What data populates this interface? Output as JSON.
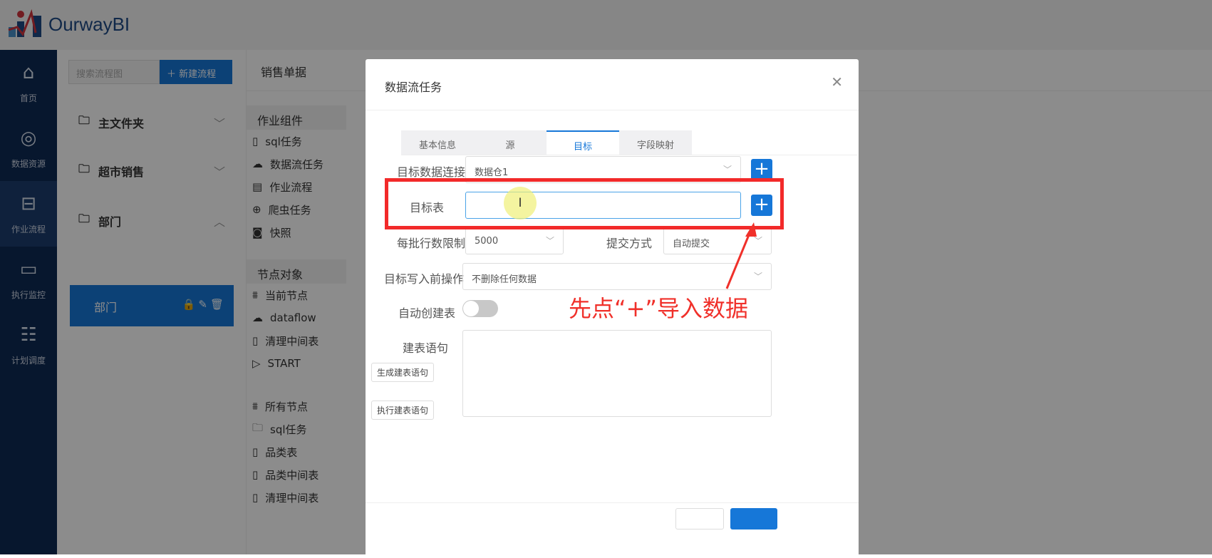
{
  "app": {
    "brand": "OurwayBI"
  },
  "sidebar": {
    "items": [
      {
        "label": "首页",
        "icon": "home-icon"
      },
      {
        "label": "数据资源",
        "icon": "globe-icon"
      },
      {
        "label": "作业流程",
        "icon": "flow-icon"
      },
      {
        "label": "执行监控",
        "icon": "monitor-icon"
      },
      {
        "label": "计划调度",
        "icon": "schedule-icon"
      }
    ]
  },
  "tree": {
    "search_placeholder": "搜索流程图",
    "new_button": "新建流程",
    "folders": [
      "主文件夹",
      "超市销售",
      "部门"
    ],
    "selected": "部门"
  },
  "panel": {
    "tab": "销售单据",
    "components_title": "作业组件",
    "components": [
      "sql任务",
      "数据流任务",
      "作业流程",
      "爬虫任务",
      "快照"
    ],
    "nodes_title": "节点对象",
    "current_nodes_label": "当前节点",
    "current_nodes": [
      "dataflow",
      "清理中间表",
      "START"
    ],
    "all_nodes_label": "所有节点",
    "all_nodes": [
      "sql任务",
      "品类表",
      "品类中间表",
      "清理中间表"
    ]
  },
  "modal": {
    "title": "数据流任务",
    "tabs": [
      "基本信息",
      "源",
      "目标",
      "字段映射"
    ],
    "active_tab": "目标",
    "target_conn_label": "目标数据连接",
    "target_conn_value": "数据仓1",
    "target_table_label": "目标表",
    "target_table_value": "",
    "batch_label": "每批行数限制",
    "batch_value": "5000",
    "commit_label": "提交方式",
    "commit_value": "自动提交",
    "pre_op_label": "目标写入前操作",
    "pre_op_value": "不删除任何数据",
    "auto_create_label": "自动创建表",
    "auto_create_on": false,
    "ddl_label": "建表语句",
    "gen_ddl": "生成建表语句",
    "exec_ddl": "执行建表语句"
  },
  "annotation": {
    "text": "先点“+”导入数据",
    "color": "#f0302a"
  }
}
